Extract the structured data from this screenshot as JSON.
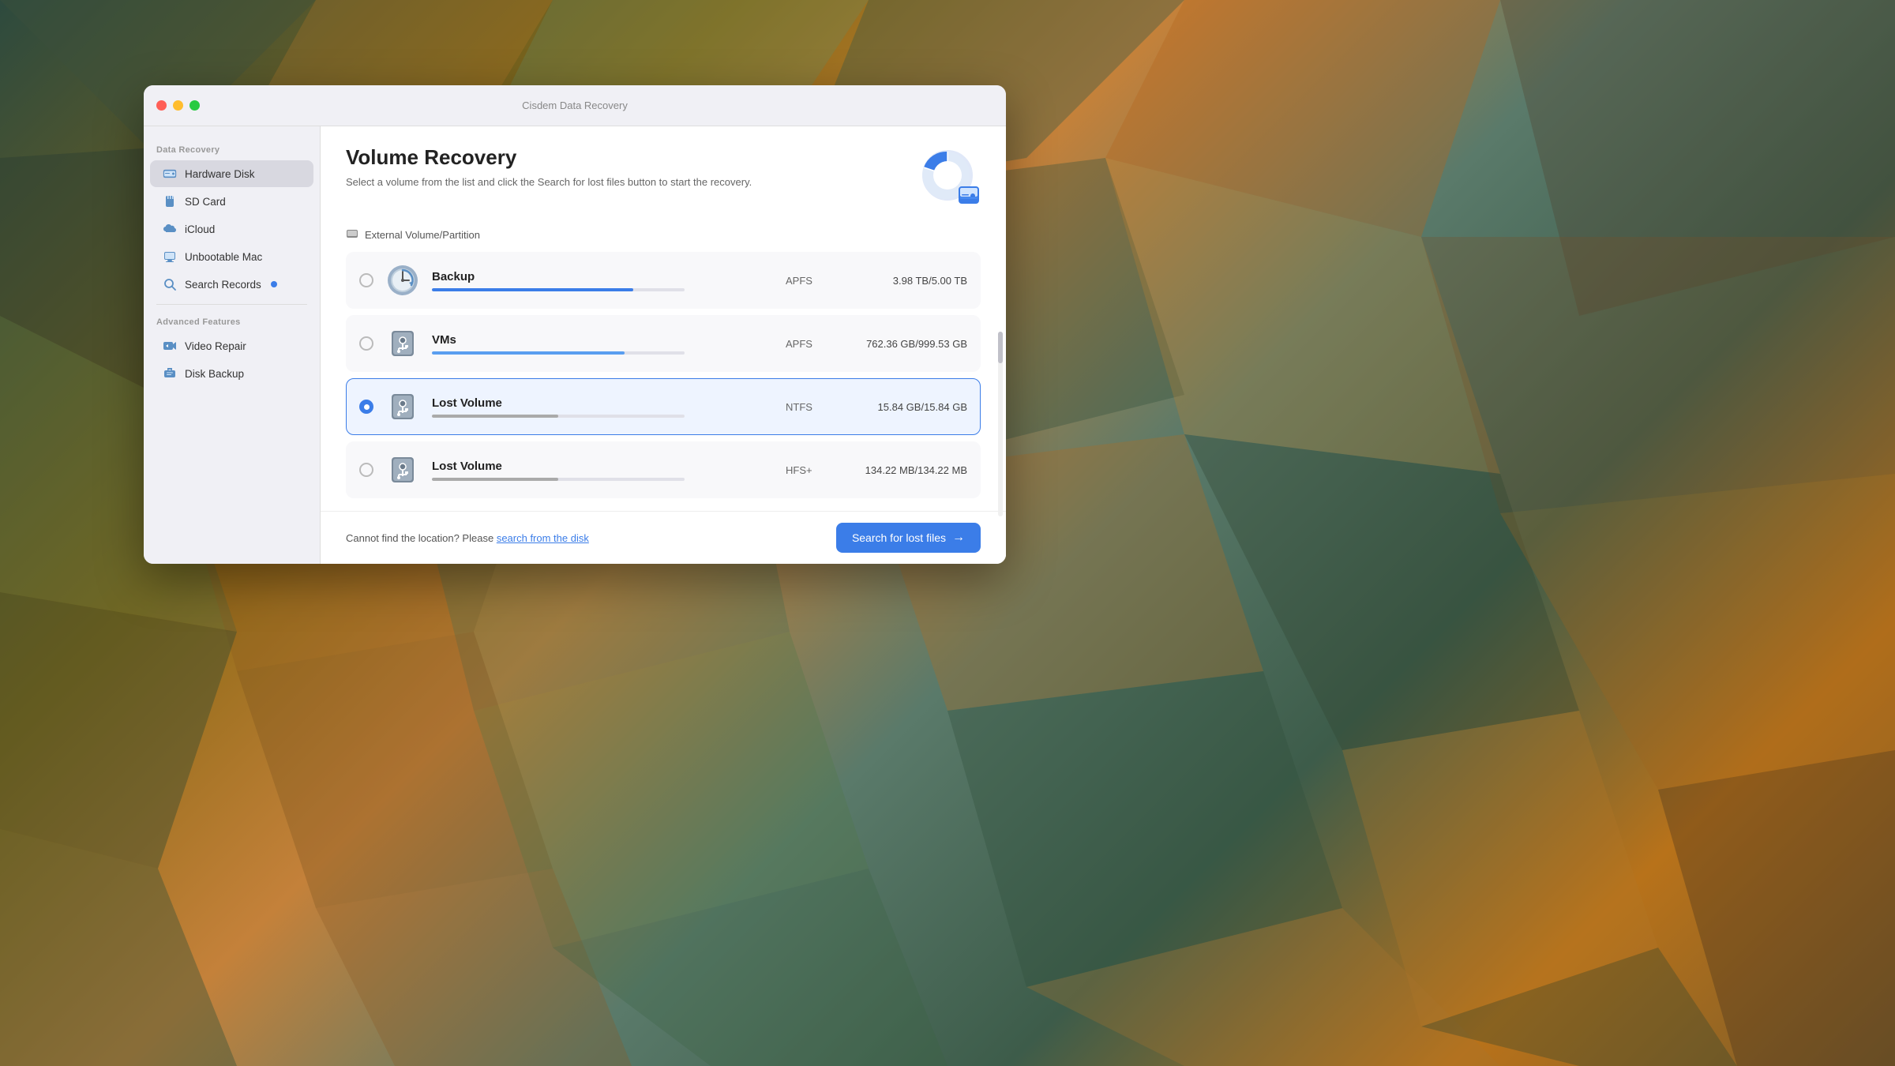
{
  "window": {
    "title": "Cisdem Data Recovery",
    "traffic_lights": {
      "close": "close",
      "minimize": "minimize",
      "maximize": "maximize"
    }
  },
  "sidebar": {
    "data_recovery_label": "Data Recovery",
    "items": [
      {
        "id": "hardware-disk",
        "label": "Hardware Disk",
        "active": true
      },
      {
        "id": "sd-card",
        "label": "SD Card",
        "active": false
      },
      {
        "id": "icloud",
        "label": "iCloud",
        "active": false
      },
      {
        "id": "unbootable-mac",
        "label": "Unbootable Mac",
        "active": false
      },
      {
        "id": "search-records",
        "label": "Search Records",
        "badge": true,
        "active": false
      }
    ],
    "advanced_features_label": "Advanced Features",
    "advanced_items": [
      {
        "id": "video-repair",
        "label": "Video Repair"
      },
      {
        "id": "disk-backup",
        "label": "Disk Backup"
      }
    ]
  },
  "main": {
    "title": "Volume Recovery",
    "subtitle": "Select a volume from the list and click the Search for lost files button to start the recovery.",
    "section_header": "External Volume/Partition",
    "volumes": [
      {
        "id": "backup",
        "name": "Backup",
        "icon_type": "backup",
        "fs": "APFS",
        "size": "3.98 TB/5.00 TB",
        "fill_pct": 79.6,
        "fill_color": "fill-blue",
        "selected": false
      },
      {
        "id": "vms",
        "name": "VMs",
        "icon_type": "usb",
        "fs": "APFS",
        "size": "762.36 GB/999.53 GB",
        "fill_pct": 76.3,
        "fill_color": "fill-blue-light",
        "selected": false
      },
      {
        "id": "lost-volume-1",
        "name": "Lost Volume",
        "icon_type": "usb",
        "fs": "NTFS",
        "size": "15.84 GB/15.84 GB",
        "fill_pct": 50,
        "fill_color": "fill-gray",
        "selected": true
      },
      {
        "id": "lost-volume-2",
        "name": "Lost Volume",
        "icon_type": "usb",
        "fs": "HFS+",
        "size": "134.22 MB/134.22 MB",
        "fill_pct": 50,
        "fill_color": "fill-gray",
        "selected": false
      }
    ],
    "footer": {
      "text": "Cannot find the location? Please ",
      "link_text": "search from the disk",
      "button_label": "Search for lost files"
    }
  }
}
